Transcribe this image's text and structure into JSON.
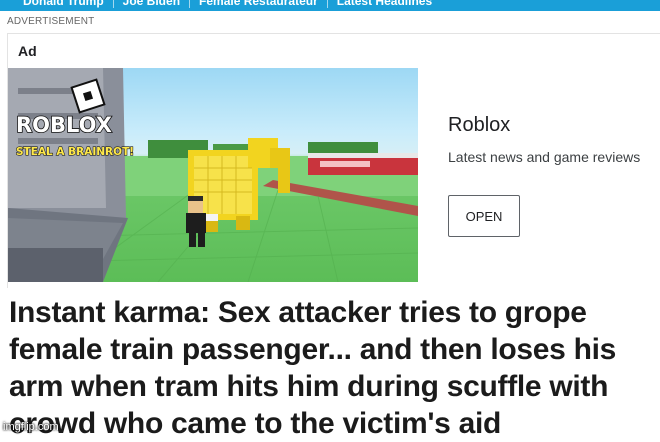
{
  "nav": {
    "items": [
      "Donald Trump",
      "Joe Biden",
      "Female Restaurateur",
      "Latest Headlines"
    ]
  },
  "ad": {
    "advertisement_label": "ADVERTISEMENT",
    "ad_tag": "Ad",
    "image": {
      "logo_text": "ROBLOX",
      "tagline": "STEAL A BRAINROT!"
    },
    "advertiser": "Roblox",
    "description": "Latest news and game reviews",
    "cta_label": "OPEN"
  },
  "article": {
    "headline": "Instant karma: Sex attacker tries to grope female train passenger... and then loses his arm when tram hits him during scuffle with crowd who came to the victim's aid"
  },
  "watermark": "imgflip.com",
  "colors": {
    "nav_bg": "#1a9fd8",
    "headline_text": "#1b1b1b",
    "ad_image_grass": "#5cbd57",
    "ad_image_sky": "#9dd8f4"
  }
}
